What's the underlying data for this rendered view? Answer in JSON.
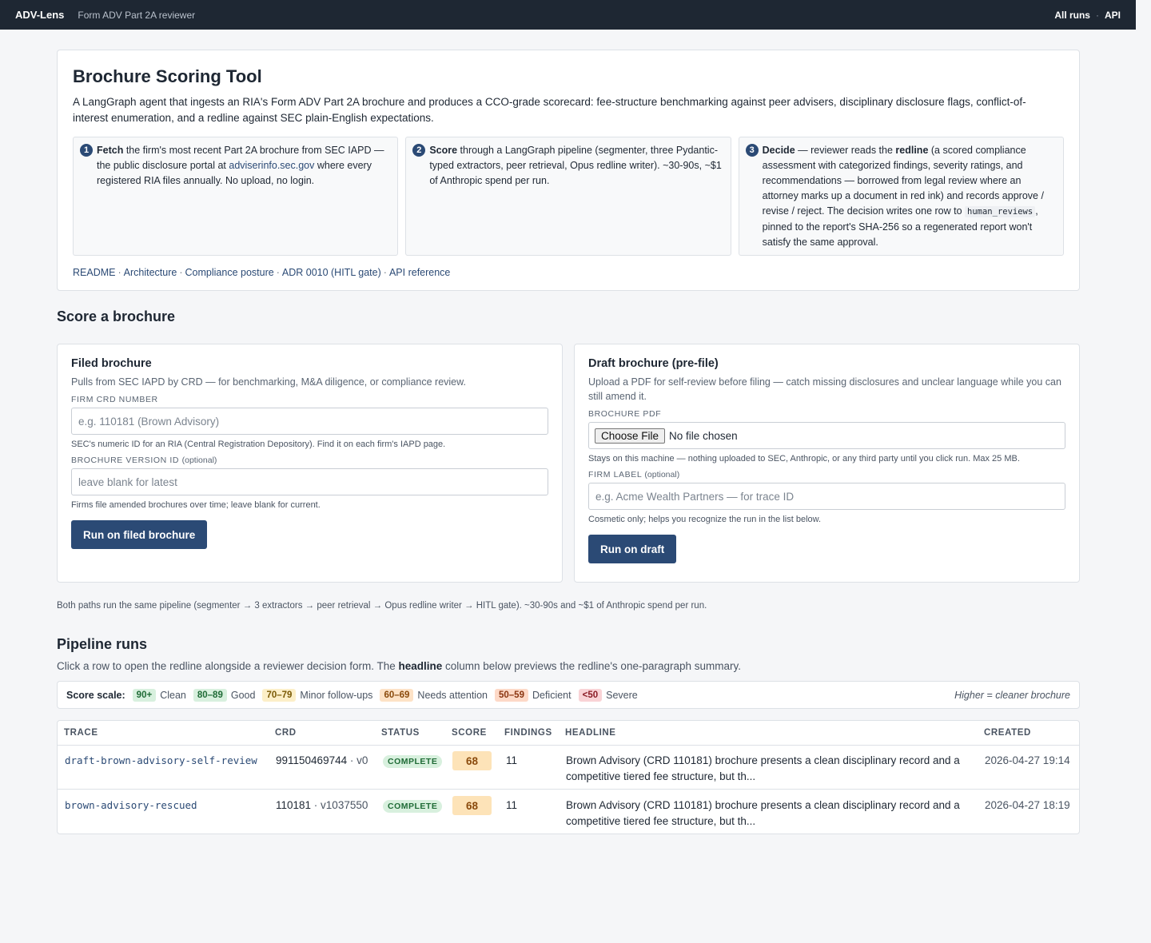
{
  "topbar": {
    "brand": "ADV-Lens",
    "tagline": "Form ADV Part 2A reviewer",
    "nav_all_runs": "All runs",
    "nav_sep": "·",
    "nav_api": "API"
  },
  "hero": {
    "title": "Brochure Scoring Tool",
    "intro": "A LangGraph agent that ingests an RIA's Form ADV Part 2A brochure and produces a CCO-grade scorecard: fee-structure benchmarking against peer advisers, disciplinary disclosure flags, conflict-of-interest enumeration, and a redline against SEC plain-English expectations.",
    "steps": [
      {
        "num": "1",
        "title": "Fetch",
        "text_a": " the firm's most recent Part 2A brochure from SEC IAPD — the public disclosure portal at ",
        "link": "adviserinfo.sec.gov",
        "text_b": " where every registered RIA files annually. No upload, no login."
      },
      {
        "num": "2",
        "title": "Score",
        "text_a": " through a LangGraph pipeline (segmenter, three Pydantic-typed extractors, peer retrieval, Opus redline writer). ~30-90s, ~$1 of Anthropic spend per run."
      },
      {
        "num": "3",
        "title": "Decide",
        "text_a": " — reviewer reads the ",
        "bold": "redline",
        "text_b": " (a scored compliance assessment with categorized findings, severity ratings, and recommendations — borrowed from legal review where an attorney marks up a document in red ink) and records approve / revise / reject. The decision writes one row to ",
        "code": "human_reviews",
        "text_c": ", pinned to the report's SHA-256 so a regenerated report won't satisfy the same approval."
      }
    ],
    "links": [
      "README",
      "Architecture",
      "Compliance posture",
      "ADR 0010 (HITL gate)",
      "API reference"
    ],
    "link_sep": "·"
  },
  "score_section": {
    "title": "Score a brochure"
  },
  "filed": {
    "title": "Filed brochure",
    "desc": "Pulls from SEC IAPD by CRD — for benchmarking, M&A diligence, or compliance review.",
    "crd_label": "FIRM CRD NUMBER",
    "crd_placeholder": "e.g. 110181 (Brown Advisory)",
    "crd_value": "",
    "crd_help": "SEC's numeric ID for an RIA (Central Registration Depository). Find it on each firm's IAPD page.",
    "version_label": "BROCHURE VERSION ID",
    "version_opt": "(optional)",
    "version_placeholder": "leave blank for latest",
    "version_value": "",
    "version_help": "Firms file amended brochures over time; leave blank for current.",
    "button": "Run on filed brochure"
  },
  "draft": {
    "title": "Draft brochure (pre-file)",
    "desc": "Upload a PDF for self-review before filing — catch missing disclosures and unclear language while you can still amend it.",
    "pdf_label": "BROCHURE PDF",
    "choose_file": "Choose File",
    "no_file": "No file chosen",
    "pdf_help": "Stays on this machine — nothing uploaded to SEC, Anthropic, or any third party until you click run. Max 25 MB.",
    "firm_label": "FIRM LABEL",
    "firm_opt": "(optional)",
    "firm_placeholder": "e.g. Acme Wealth Partners — for trace ID",
    "firm_value": "",
    "firm_help": "Cosmetic only; helps you recognize the run in the list below.",
    "button": "Run on draft"
  },
  "pipeline_note": "Both paths run the same pipeline (segmenter → 3 extractors → peer retrieval → Opus redline writer → HITL gate). ~30-90s and ~$1 of Anthropic spend per run.",
  "runs": {
    "title": "Pipeline runs",
    "desc_a": "Click a row to open the redline alongside a reviewer decision form. The ",
    "desc_bold": "headline",
    "desc_b": " column below previews the redline's one-paragraph summary."
  },
  "scale": {
    "title": "Score scale:",
    "items": [
      {
        "chip": "90+",
        "label": "Clean",
        "color": "#d8f0de"
      },
      {
        "chip": "80–89",
        "label": "Good",
        "color": "#d8f0de"
      },
      {
        "chip": "70–79",
        "label": "Minor follow-ups",
        "color": "#fcefc8"
      },
      {
        "chip": "60–69",
        "label": "Needs attention",
        "color": "#fde2c6"
      },
      {
        "chip": "50–59",
        "label": "Deficient",
        "color": "#fdd9c7"
      },
      {
        "chip": "<50",
        "label": "Severe",
        "color": "#f9d3d6"
      }
    ],
    "note": "Higher = cleaner brochure"
  },
  "table": {
    "columns": [
      "TRACE",
      "CRD",
      "STATUS",
      "SCORE",
      "FINDINGS",
      "HEADLINE",
      "CREATED"
    ],
    "rows": [
      {
        "trace": "draft-brown-advisory-self-review",
        "crd": "991150469744",
        "version": "v0",
        "status": "COMPLETE",
        "score": "68",
        "findings": "11",
        "headline": "Brown Advisory (CRD 110181) brochure presents a clean disciplinary record and a competitive tiered fee structure, but th...",
        "created": "2026-04-27 19:14"
      },
      {
        "trace": "brown-advisory-rescued",
        "crd": "110181",
        "version": "v1037550",
        "status": "COMPLETE",
        "score": "68",
        "findings": "11",
        "headline": "Brown Advisory (CRD 110181) brochure presents a clean disciplinary record and a competitive tiered fee structure, but th...",
        "created": "2026-04-27 18:19"
      }
    ],
    "crd_sep": " · "
  }
}
